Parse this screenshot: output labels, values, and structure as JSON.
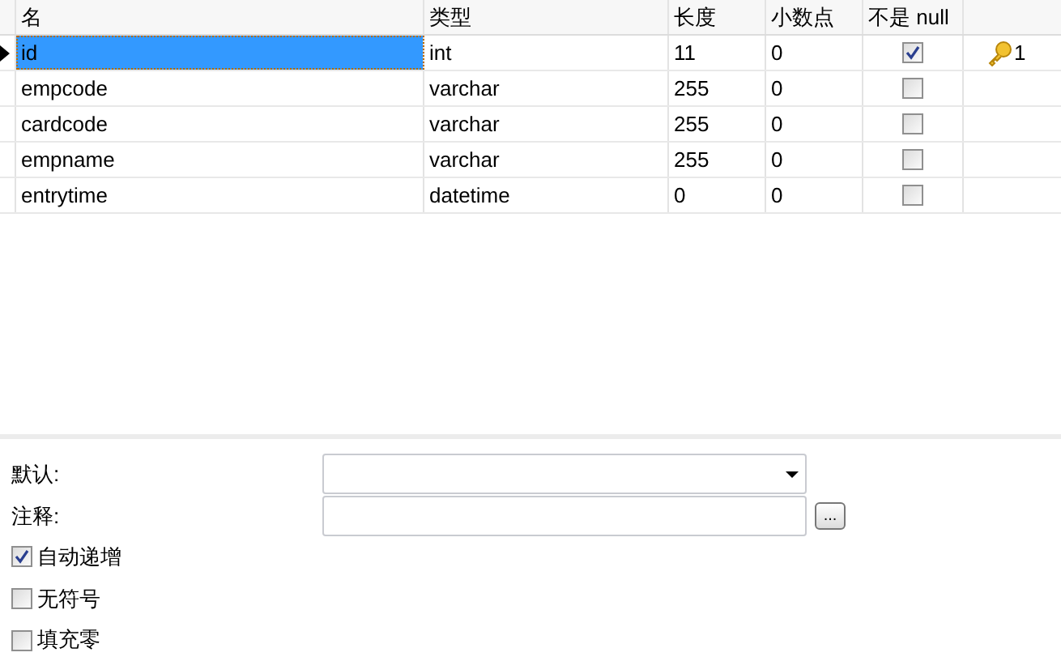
{
  "table": {
    "columns": [
      "名",
      "类型",
      "长度",
      "小数点",
      "不是 null"
    ],
    "rows": [
      {
        "name": "id",
        "type": "int",
        "length": "11",
        "decimals": "0",
        "not_null": true,
        "selected": true,
        "key": "1"
      },
      {
        "name": "empcode",
        "type": "varchar",
        "length": "255",
        "decimals": "0",
        "not_null": false,
        "selected": false
      },
      {
        "name": "cardcode",
        "type": "varchar",
        "length": "255",
        "decimals": "0",
        "not_null": false,
        "selected": false
      },
      {
        "name": "empname",
        "type": "varchar",
        "length": "255",
        "decimals": "0",
        "not_null": false,
        "selected": false
      },
      {
        "name": "entrytime",
        "type": "datetime",
        "length": "0",
        "decimals": "0",
        "not_null": false,
        "selected": false
      }
    ]
  },
  "form": {
    "default_label": "默认:",
    "comment_label": "注释:",
    "browse_button": "...",
    "options": [
      {
        "label": "自动递增",
        "checked": true
      },
      {
        "label": "无符号",
        "checked": false
      },
      {
        "label": "填充零",
        "checked": false
      }
    ]
  }
}
